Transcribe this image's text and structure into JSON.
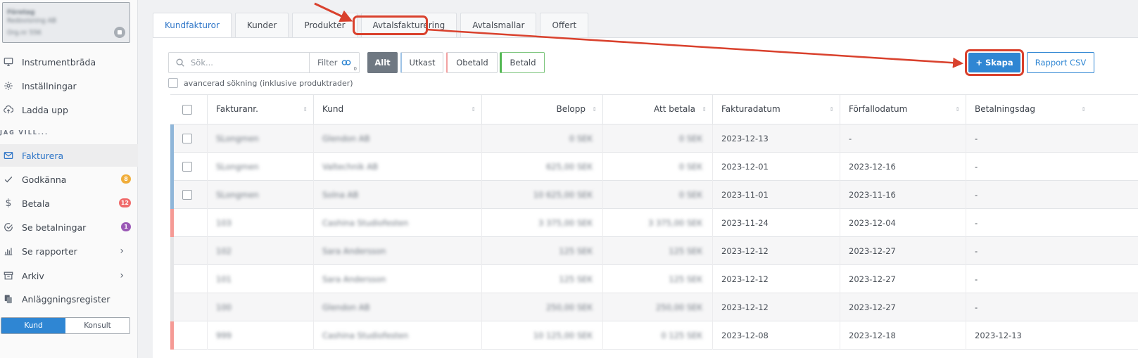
{
  "company": {
    "name_blurred": "Företag",
    "line2_blurred": "Redovisning AB",
    "line3_blurred": "Org.nr 556"
  },
  "sidebar": {
    "items": [
      {
        "label": "Instrumentbräda",
        "icon": "monitor-icon"
      },
      {
        "label": "Inställningar",
        "icon": "gear-icon"
      },
      {
        "label": "Ladda upp",
        "icon": "cloud-upload-icon"
      },
      {
        "label": "Fakturera",
        "icon": "envelope-icon"
      },
      {
        "label": "Godkänna",
        "icon": "check-icon",
        "badge": "8"
      },
      {
        "label": "Betala",
        "icon": "dollar-icon",
        "badge": "12"
      },
      {
        "label": "Se betalningar",
        "icon": "check-circle-icon",
        "badge": "1"
      },
      {
        "label": "Se rapporter",
        "icon": "bar-chart-icon"
      },
      {
        "label": "Arkiv",
        "icon": "archive-icon"
      },
      {
        "label": "Anläggningsregister",
        "icon": "copy-icon"
      }
    ],
    "section_label": "JAG VILL...",
    "role_kund": "Kund",
    "role_konsult": "Konsult"
  },
  "colors": {
    "accent": "#2f86d3",
    "badge_orange": "#f0ad3a",
    "badge_red": "#f06a6a",
    "badge_purple": "#9b59b6",
    "stripe_blue": "#8fb6d9",
    "stripe_red": "#f59a95",
    "annotation_red": "#d9412d"
  },
  "tabs": [
    "Kundfakturor",
    "Kunder",
    "Produkter",
    "Avtalsfakturering",
    "Avtalsmallar",
    "Offert"
  ],
  "toolbar": {
    "search_placeholder": "Sök...",
    "filter_label": "Filter",
    "filter_count": "0",
    "status_all": "Allt",
    "status_draft": "Utkast",
    "status_unpaid": "Obetald",
    "status_paid": "Betald",
    "advanced_search": "avancerad sökning (inklusive produktrader)",
    "create_label": "Skapa",
    "csv_label": "Rapport CSV"
  },
  "table": {
    "columns": [
      "Fakturanr.",
      "Kund",
      "Belopp",
      "Att betala",
      "Fakturadatum",
      "Förfallodatum",
      "Betalningsdag"
    ],
    "rows": [
      {
        "nr": "SLongmen",
        "kund": "Glendon AB",
        "belopp": "0 SEK",
        "att": "0 SEK",
        "fdatum": "2023-12-13",
        "forfall": "-",
        "betald": "-",
        "stripe": "blue",
        "check": true
      },
      {
        "nr": "SLongmen",
        "kund": "Valtechnik AB",
        "belopp": "625,00 SEK",
        "att": "0 SEK",
        "fdatum": "2023-12-01",
        "forfall": "2023-12-16",
        "betald": "-",
        "stripe": "blue",
        "check": true
      },
      {
        "nr": "SLongmen",
        "kund": "Solna AB",
        "belopp": "10 625,00 SEK",
        "att": "0 SEK",
        "fdatum": "2023-11-01",
        "forfall": "2023-11-16",
        "betald": "-",
        "stripe": "blue",
        "check": true
      },
      {
        "nr": "103",
        "kund": "Cashina Studiofesten",
        "belopp": "3 375,00 SEK",
        "att": "3 375,00 SEK",
        "fdatum": "2023-11-24",
        "forfall": "2023-12-04",
        "betald": "-",
        "stripe": "red",
        "check": false
      },
      {
        "nr": "102",
        "kund": "Sara Andersson",
        "belopp": "125 SEK",
        "att": "125 SEK",
        "fdatum": "2023-12-12",
        "forfall": "2023-12-27",
        "betald": "-",
        "stripe": "grey",
        "check": false
      },
      {
        "nr": "101",
        "kund": "Sara Andersson",
        "belopp": "125 SEK",
        "att": "125 SEK",
        "fdatum": "2023-12-12",
        "forfall": "2023-12-27",
        "betald": "-",
        "stripe": "grey",
        "check": false
      },
      {
        "nr": "100",
        "kund": "Glendon AB",
        "belopp": "250,00 SEK",
        "att": "250,00 SEK",
        "fdatum": "2023-12-12",
        "forfall": "2023-12-27",
        "betald": "-",
        "stripe": "grey",
        "check": false
      },
      {
        "nr": "999",
        "kund": "Cashina Studiofesten",
        "belopp": "10 125,00 SEK",
        "att": "0 125 SEK",
        "fdatum": "2023-12-08",
        "forfall": "2023-12-18",
        "betald": "2023-12-13",
        "stripe": "red",
        "check": false
      }
    ]
  }
}
